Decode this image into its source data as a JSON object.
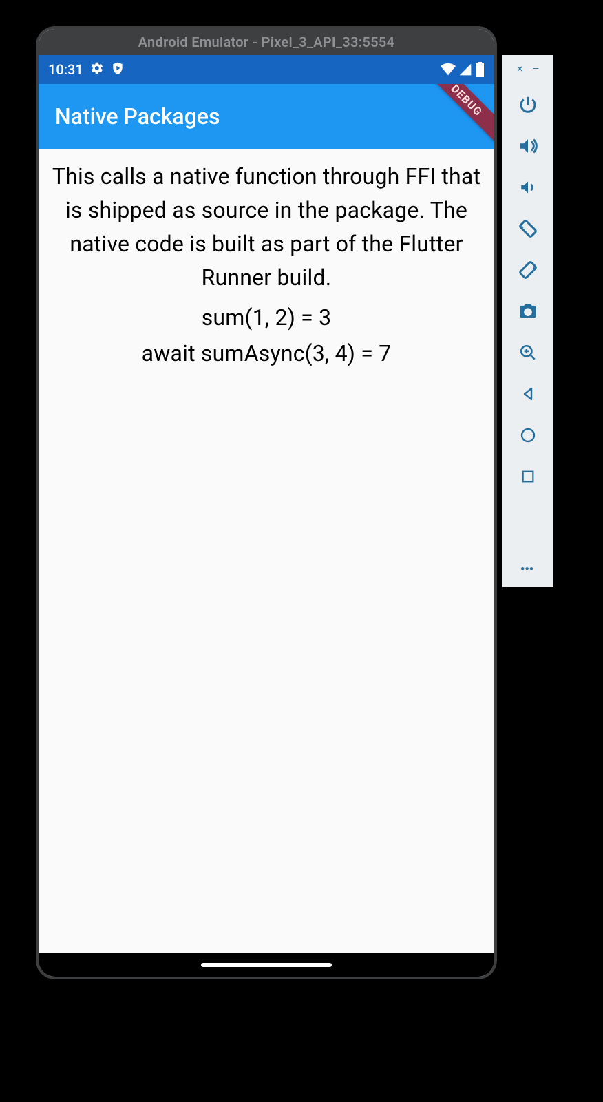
{
  "window": {
    "title": "Android Emulator - Pixel_3_API_33:5554"
  },
  "status_bar": {
    "time": "10:31",
    "icons_left": [
      "settings-gear-icon",
      "shield-play-icon"
    ],
    "icons_right": [
      "wifi-icon",
      "cell-signal-icon",
      "battery-icon"
    ]
  },
  "app_bar": {
    "title": "Native Packages",
    "debug_banner": "DEBUG"
  },
  "content": {
    "description": "This calls a native function through FFI that is shipped as source in the package. The native code is built as part of the Flutter Runner build.",
    "line1": "sum(1, 2) = 3",
    "line2": "await sumAsync(3, 4) = 7"
  },
  "emulator_toolbar": {
    "close": "×",
    "minimize": "—",
    "buttons": [
      "power-icon",
      "volume-up-icon",
      "volume-down-icon",
      "rotate-left-icon",
      "rotate-right-icon",
      "camera-icon",
      "zoom-in-icon",
      "back-icon",
      "home-icon",
      "overview-icon"
    ],
    "more": "…"
  }
}
